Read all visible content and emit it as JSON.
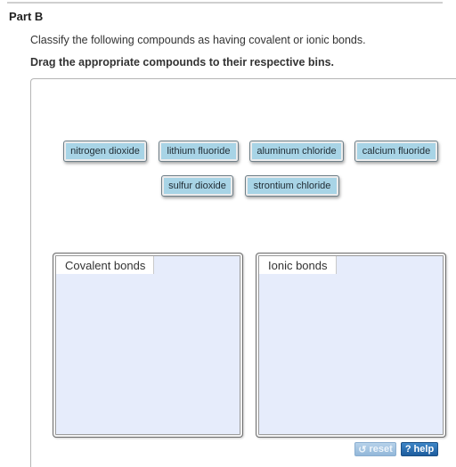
{
  "part": {
    "title": "Part B"
  },
  "instructions": {
    "text": "Classify the following compounds as having covalent or ionic bonds.",
    "bold": "Drag the appropriate compounds to their respective bins."
  },
  "tiles": [
    "nitrogen dioxide",
    "lithium fluoride",
    "aluminum chloride",
    "calcium fluoride",
    "sulfur dioxide",
    "strontium chloride"
  ],
  "bins": {
    "covalent": "Covalent bonds",
    "ionic": "Ionic bonds"
  },
  "buttons": {
    "reset": "reset",
    "help": "help",
    "reset_icon": "reset-arrow-icon",
    "help_icon": "question-mark-icon"
  },
  "colors": {
    "tile": "#a8d4e6",
    "bin": "#e6ecfb",
    "help_button": "#2a6fb0"
  }
}
